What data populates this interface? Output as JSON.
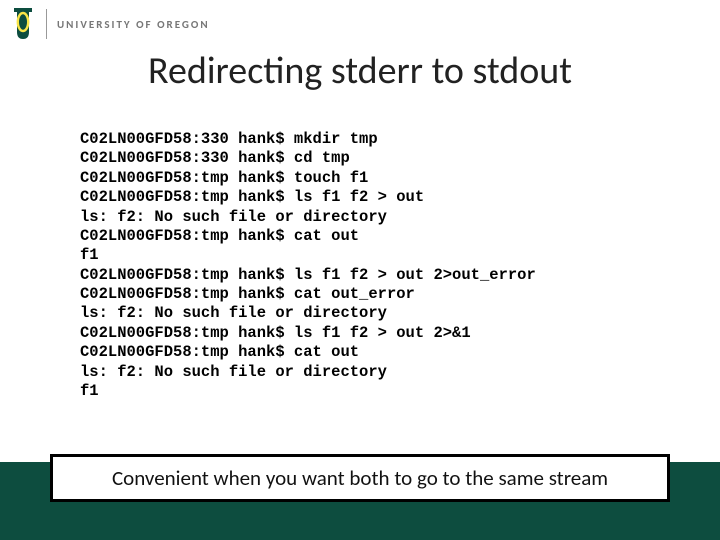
{
  "header": {
    "university": "UNIVERSITY OF OREGON"
  },
  "title": "Redirecting stderr to stdout",
  "terminal": {
    "lines": [
      "C02LN00GFD58:330 hank$ mkdir tmp",
      "C02LN00GFD58:330 hank$ cd tmp",
      "C02LN00GFD58:tmp hank$ touch f1",
      "C02LN00GFD58:tmp hank$ ls f1 f2 > out",
      "ls: f2: No such file or directory",
      "C02LN00GFD58:tmp hank$ cat out",
      "f1",
      "C02LN00GFD58:tmp hank$ ls f1 f2 > out 2>out_error",
      "C02LN00GFD58:tmp hank$ cat out_error",
      "ls: f2: No such file or directory",
      "C02LN00GFD58:tmp hank$ ls f1 f2 > out 2>&1",
      "C02LN00GFD58:tmp hank$ cat out",
      "ls: f2: No such file or directory",
      "f1"
    ]
  },
  "caption": "Convenient when you want both to go to the same stream",
  "colors": {
    "brand_green": "#0d4d3f",
    "brand_yellow": "#f9e547"
  }
}
